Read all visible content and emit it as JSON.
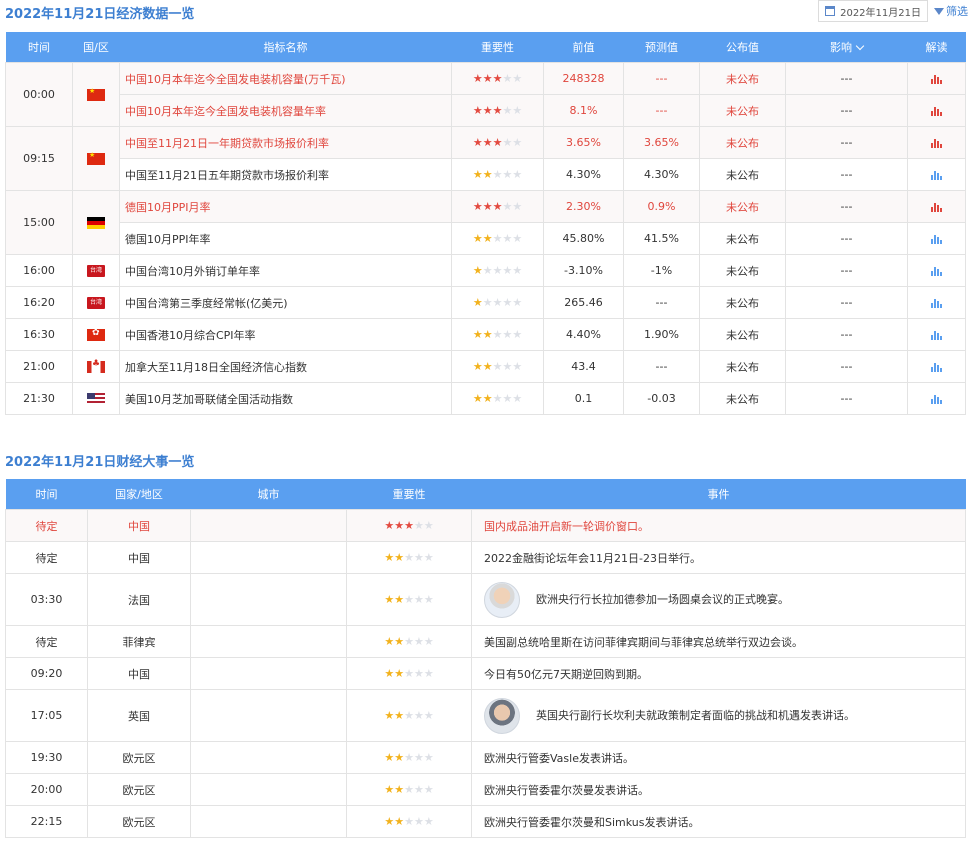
{
  "econ": {
    "title": "2022年11月21日经济数据一览",
    "date_label": "2022年11月21日",
    "filter_label": "筛选",
    "headers": {
      "time": "时间",
      "region": "国/区",
      "name": "指标名称",
      "importance": "重要性",
      "prev": "前值",
      "forecast": "预测值",
      "actual": "公布值",
      "impact": "影响",
      "interp": "解读"
    },
    "rows": [
      {
        "time": "00:00",
        "flag": "cn",
        "name": "中国10月本年迄今全国发电装机容量(万千瓦)",
        "stars": 3,
        "prev": "248328",
        "forecast": "---",
        "actual": "未公布",
        "impact": "---",
        "hl": true
      },
      {
        "name": "中国10月本年迄今全国发电装机容量年率",
        "stars": 3,
        "prev": "8.1%",
        "forecast": "---",
        "actual": "未公布",
        "impact": "---",
        "hl": true
      },
      {
        "time": "09:15",
        "flag": "cn",
        "name": "中国至11月21日一年期贷款市场报价利率",
        "stars": 3,
        "prev": "3.65%",
        "forecast": "3.65%",
        "actual": "未公布",
        "impact": "---",
        "hl": true
      },
      {
        "name": "中国至11月21日五年期贷款市场报价利率",
        "stars": 2,
        "prev": "4.30%",
        "forecast": "4.30%",
        "actual": "未公布",
        "impact": "---",
        "hl": false
      },
      {
        "time": "15:00",
        "flag": "de",
        "name": "德国10月PPI月率",
        "stars": 3,
        "prev": "2.30%",
        "forecast": "0.9%",
        "actual": "未公布",
        "impact": "---",
        "hl": true
      },
      {
        "name": "德国10月PPI年率",
        "stars": 2,
        "prev": "45.80%",
        "forecast": "41.5%",
        "actual": "未公布",
        "impact": "---",
        "hl": false
      },
      {
        "time": "16:00",
        "flag": "tw",
        "flag_text": "台湾",
        "name": "中国台湾10月外销订单年率",
        "stars": 1,
        "prev": "-3.10%",
        "forecast": "-1%",
        "actual": "未公布",
        "impact": "---",
        "hl": false
      },
      {
        "time": "16:20",
        "flag": "tw",
        "flag_text": "台湾",
        "name": "中国台湾第三季度经常帐(亿美元)",
        "stars": 1,
        "prev": "265.46",
        "forecast": "---",
        "actual": "未公布",
        "impact": "---",
        "hl": false
      },
      {
        "time": "16:30",
        "flag": "hk",
        "name": "中国香港10月综合CPI年率",
        "stars": 2,
        "prev": "4.40%",
        "forecast": "1.90%",
        "actual": "未公布",
        "impact": "---",
        "hl": false
      },
      {
        "time": "21:00",
        "flag": "ca",
        "name": "加拿大至11月18日全国经济信心指数",
        "stars": 2,
        "prev": "43.4",
        "forecast": "---",
        "actual": "未公布",
        "impact": "---",
        "hl": false
      },
      {
        "time": "21:30",
        "flag": "us",
        "name": "美国10月芝加哥联储全国活动指数",
        "stars": 2,
        "prev": "0.1",
        "forecast": "-0.03",
        "actual": "未公布",
        "impact": "---",
        "hl": false
      }
    ]
  },
  "events": {
    "title": "2022年11月21日财经大事一览",
    "headers": {
      "time": "时间",
      "country": "国家/地区",
      "city": "城市",
      "importance": "重要性",
      "event": "事件"
    },
    "rows": [
      {
        "time": "待定",
        "country": "中国",
        "city": "",
        "stars": 3,
        "event": "国内成品油开启新一轮调价窗口。",
        "hl": true
      },
      {
        "time": "待定",
        "country": "中国",
        "city": "",
        "stars": 2,
        "event": "2022金融街论坛年会11月21日-23日举行。",
        "hl": false
      },
      {
        "time": "03:30",
        "country": "法国",
        "city": "",
        "stars": 2,
        "event": "欧洲央行行长拉加德参加一场圆桌会议的正式晚宴。",
        "hl": false,
        "avatar": "lagarde"
      },
      {
        "time": "待定",
        "country": "菲律宾",
        "city": "",
        "stars": 2,
        "event": "美国副总统哈里斯在访问菲律宾期间与菲律宾总统举行双边会谈。",
        "hl": false
      },
      {
        "time": "09:20",
        "country": "中国",
        "city": "",
        "stars": 2,
        "event": "今日有50亿元7天期逆回购到期。",
        "hl": false
      },
      {
        "time": "17:05",
        "country": "英国",
        "city": "",
        "stars": 2,
        "event": "英国央行副行长坎利夫就政策制定者面临的挑战和机遇发表讲话。",
        "hl": false,
        "avatar": "cunliffe"
      },
      {
        "time": "19:30",
        "country": "欧元区",
        "city": "",
        "stars": 2,
        "event": "欧洲央行管委Vasle发表讲话。",
        "hl": false
      },
      {
        "time": "20:00",
        "country": "欧元区",
        "city": "",
        "stars": 2,
        "event": "欧洲央行管委霍尔茨曼发表讲话。",
        "hl": false
      },
      {
        "time": "22:15",
        "country": "欧元区",
        "city": "",
        "stars": 2,
        "event": "欧洲央行管委霍尔茨曼和Simkus发表讲话。",
        "hl": false
      }
    ]
  }
}
